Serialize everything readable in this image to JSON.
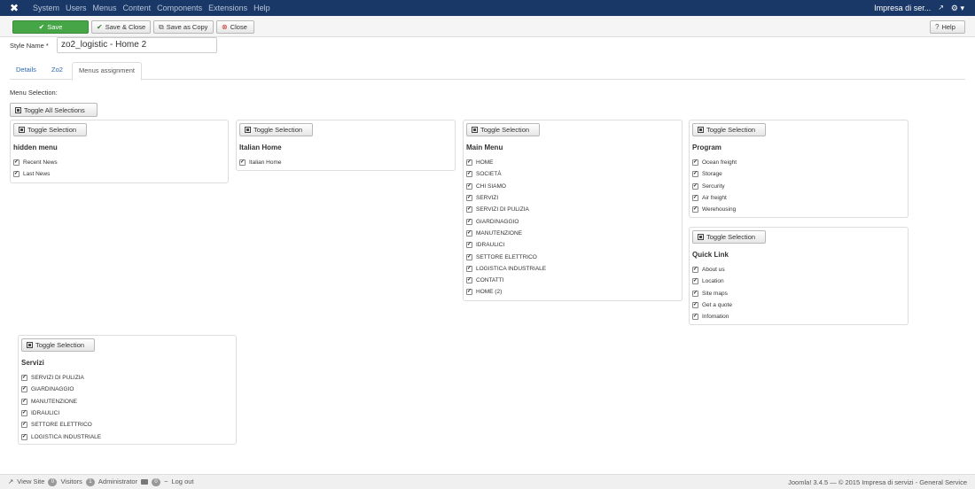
{
  "navbar": {
    "menu": [
      "System",
      "Users",
      "Menus",
      "Content",
      "Components",
      "Extensions",
      "Help"
    ],
    "site_name": "Impresa di ser..."
  },
  "toolbar": {
    "save": "Save",
    "save_close": "Save & Close",
    "save_copy": "Save as Copy",
    "close": "Close",
    "help": "Help"
  },
  "form": {
    "style_name_label": "Style Name *",
    "style_name_value": "zo2_logistic - Home 2"
  },
  "tabs": [
    "Details",
    "Zo2",
    "Menus assignment"
  ],
  "menu_selection_label": "Menu Selection:",
  "toggle_all": "Toggle All Selections",
  "toggle_label": "Toggle Selection",
  "panels": [
    {
      "title": "hidden menu",
      "items": [
        "Recent News",
        "Last News"
      ]
    },
    {
      "title": "Italian Home",
      "items": [
        "Italian Home"
      ]
    },
    {
      "title": "Main Menu",
      "items": [
        "HOME",
        "SOCIETÀ",
        "CHI SIAMO",
        "SERVIZI",
        "SERVIZI DI PULIZIA",
        "GIARDINAGGIO",
        "MANUTENZIONE",
        "IDRAULICI",
        "SETTORE ELETTRICO",
        "LOGISTICA INDUSTRIALE",
        "CONTATTI",
        "HOME (2)"
      ]
    },
    {
      "title": "Program",
      "items": [
        "Ocean freight",
        "Storage",
        "Sercurity",
        "Air freight",
        "Werehousing"
      ]
    },
    {
      "title": "Quick Link",
      "items": [
        "About us",
        "Location",
        "Site maps",
        "Get a quote",
        "Infomation"
      ]
    },
    {
      "title": "Servizi",
      "items": [
        "SERVIZI DI PULIZIA",
        "GIARDINAGGIO",
        "MANUTENZIONE",
        "IDRAULICI",
        "SETTORE ELETTRICO",
        "LOGISTICA INDUSTRIALE"
      ]
    }
  ],
  "footer": {
    "view_site": "View Site",
    "visitors_count": "0",
    "visitors": "Visitors",
    "admin_count": "1",
    "administrator": "Administrator",
    "messages_count": "0",
    "logout": "Log out",
    "copyright": "Joomla! 3.4.5 — © 2015 Impresa di servizi - General Service"
  }
}
